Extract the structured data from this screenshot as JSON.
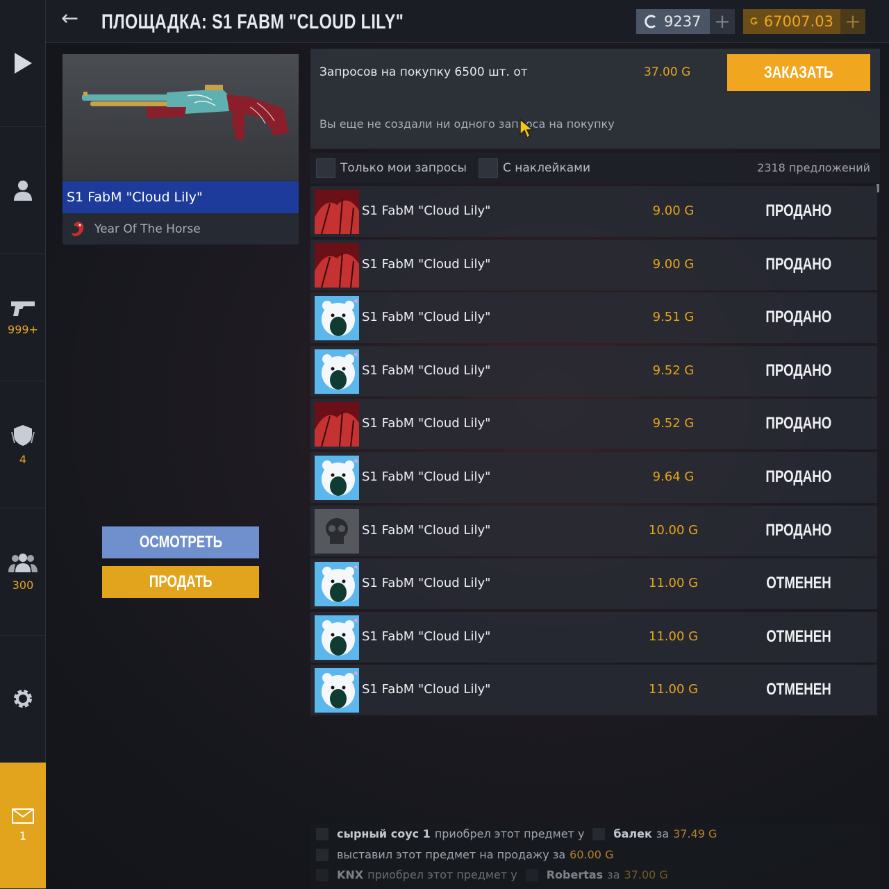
{
  "header": {
    "title": "ПЛОЩАДКА: S1 FABM \"CLOUD LILY\"",
    "crowns": "9237",
    "gold": "67007.03",
    "plus": "+"
  },
  "rail": {
    "weapons_count": "999+",
    "achievements_count": "4",
    "friends_count": "300",
    "mail_count": "1"
  },
  "item": {
    "name": "S1 FabM \"Cloud Lily\"",
    "collection": "Year Of The Horse",
    "view_label": "ОСМОТРЕТЬ",
    "sell_label": "ПРОДАТЬ"
  },
  "requests": {
    "summary": "Запросов на покупку 6500 шт. от",
    "min_price": "37.00 G",
    "order_label": "ЗАКАЗАТЬ",
    "empty_text": "Вы еще не создали ни одного запроса на покупку"
  },
  "filters": {
    "my_requests": "Только мои запросы",
    "with_stickers": "С наклейками",
    "offers_count": "2318 предложений"
  },
  "rows": [
    {
      "thumb": "red",
      "name": "S1 FabM \"Cloud Lily\"",
      "price": "9.00 G",
      "status": "ПРОДАНО"
    },
    {
      "thumb": "red",
      "name": "S1 FabM \"Cloud Lily\"",
      "price": "9.00 G",
      "status": "ПРОДАНО"
    },
    {
      "thumb": "bear",
      "name": "S1 FabM \"Cloud Lily\"",
      "price": "9.51 G",
      "status": "ПРОДАНО"
    },
    {
      "thumb": "bear",
      "name": "S1 FabM \"Cloud Lily\"",
      "price": "9.52 G",
      "status": "ПРОДАНО"
    },
    {
      "thumb": "red",
      "name": "S1 FabM \"Cloud Lily\"",
      "price": "9.52 G",
      "status": "ПРОДАНО"
    },
    {
      "thumb": "bear",
      "name": "S1 FabM \"Cloud Lily\"",
      "price": "9.64 G",
      "status": "ПРОДАНО"
    },
    {
      "thumb": "skull",
      "name": "S1 FabM \"Cloud Lily\"",
      "price": "10.00 G",
      "status": "ПРОДАНО"
    },
    {
      "thumb": "bear",
      "name": "S1 FabM \"Cloud Lily\"",
      "price": "11.00 G",
      "status": "ОТМЕНЕН"
    },
    {
      "thumb": "bear",
      "name": "S1 FabM \"Cloud Lily\"",
      "price": "11.00 G",
      "status": "ОТМЕНЕН"
    },
    {
      "thumb": "bear",
      "name": "S1 FabM \"Cloud Lily\"",
      "price": "11.00 G",
      "status": "ОТМЕНЕН"
    }
  ],
  "history": [
    {
      "user": "сырный соус 1",
      "action": "приобрел этот предмет у",
      "seller": "балек",
      "za": "за",
      "price": "37.49 G"
    },
    {
      "user": "",
      "action": "выставил этот предмет на продажу за",
      "seller": "",
      "za": "",
      "price": "60.00 G"
    },
    {
      "user": "KNX",
      "action": "приобрел этот предмет у",
      "seller": "Robertas",
      "za": "за",
      "price": "37.00 G"
    }
  ],
  "colors": {
    "accent_gold": "#e3a41d",
    "selected_blue": "#1d3b9a",
    "view_button": "#6f8fcd"
  }
}
